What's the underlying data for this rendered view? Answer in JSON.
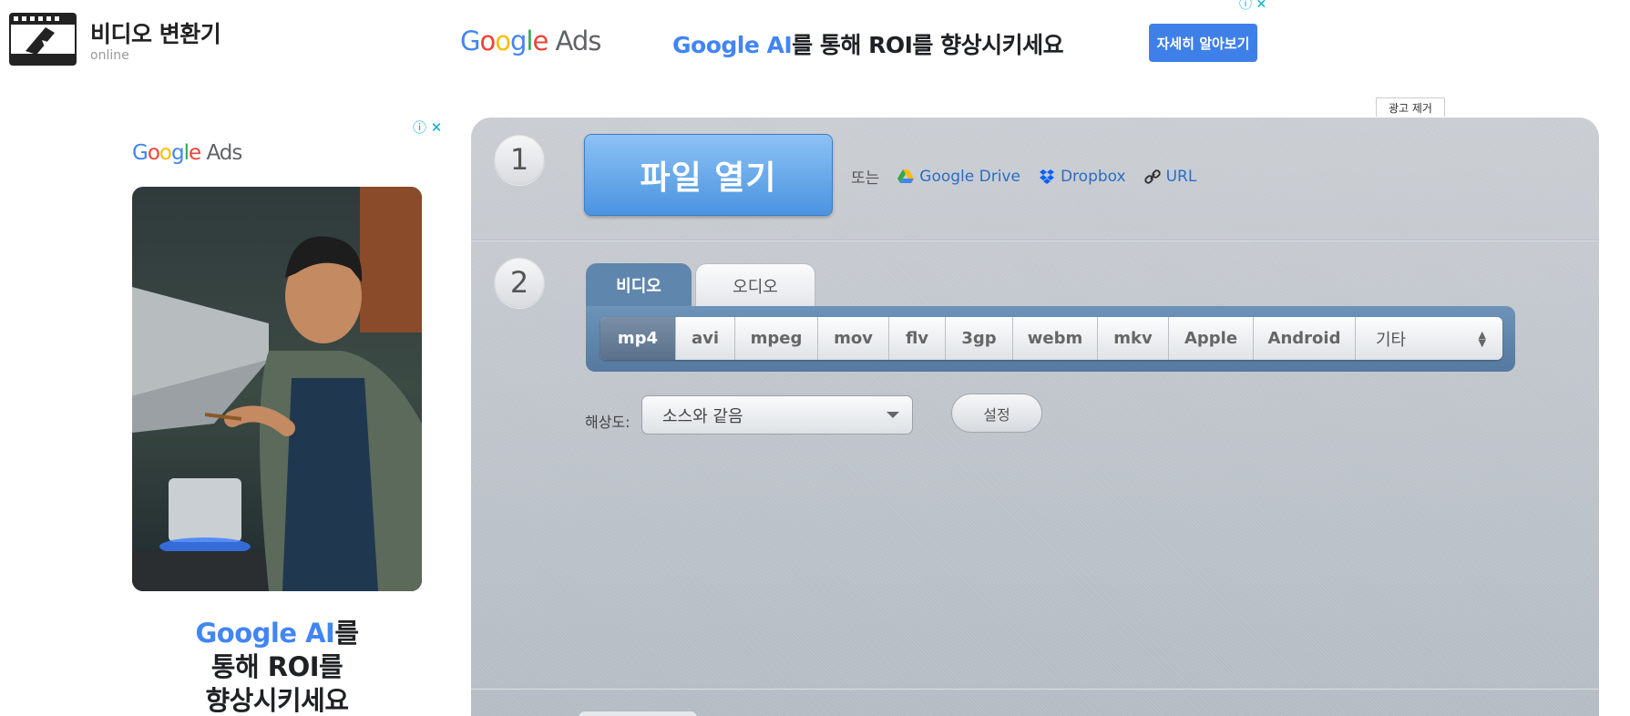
{
  "header": {
    "title": "비디오 변환기",
    "subtitle": "online"
  },
  "top_ad": {
    "logo_google": "Google",
    "logo_ads": "Ads",
    "headline_blue": "Google AI",
    "headline_rest": "를 통해 ROI를 향상시키세요",
    "cta": "자세히 알아보기",
    "adchoices_icon": "info-close-icons"
  },
  "remove_ad": "광고 제거",
  "side_ad": {
    "logo_google": "Google",
    "logo_ads": "Ads",
    "headline_line1_blue": "Google AI",
    "headline_line1_rest": "를",
    "headline_line2": "통해 ROI를",
    "headline_line3": "향상시키세요"
  },
  "steps": {
    "one": "1",
    "two": "2"
  },
  "open_file": "파일 열기",
  "sources": {
    "or": "또는",
    "google_drive": "Google Drive",
    "dropbox": "Dropbox",
    "url": "URL"
  },
  "tabs": {
    "video": "비디오",
    "audio": "오디오"
  },
  "formats": [
    "mp4",
    "avi",
    "mpeg",
    "mov",
    "flv",
    "3gp",
    "webm",
    "mkv",
    "Apple",
    "Android"
  ],
  "format_other": "기타",
  "selected_format": "mp4",
  "resolution": {
    "label": "해상도:",
    "value": "소스와 같음"
  },
  "settings_button": "설정",
  "colors": {
    "google_blue": "#4285f4",
    "cta_blue": "#3f7fe8",
    "open_button": "#4b93e0",
    "tab_active": "#5f86ad",
    "link": "#2a6dc4"
  }
}
